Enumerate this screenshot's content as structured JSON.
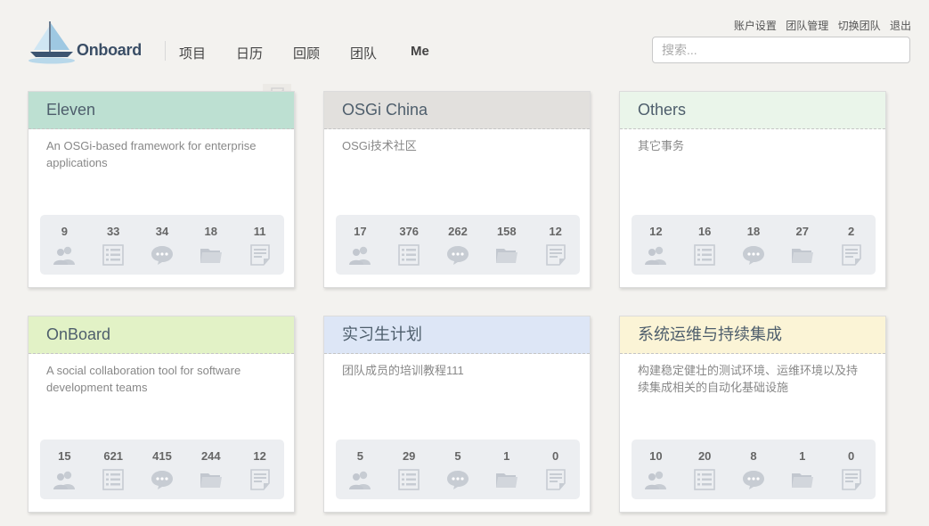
{
  "brand": {
    "name": "Onboard"
  },
  "nav": [
    "项目",
    "日历",
    "回顾",
    "团队",
    "Me"
  ],
  "account_links": [
    "账户设置",
    "团队管理",
    "切换团队",
    "退出"
  ],
  "search": {
    "placeholder": "搜索..."
  },
  "projects": [
    {
      "title": "Eleven",
      "description": "An OSGi-based framework for enterprise applications",
      "header_color": "#bde0d2",
      "stats": [
        "9",
        "33",
        "34",
        "18",
        "11"
      ]
    },
    {
      "title": "OSGi China",
      "description": "OSGi技术社区",
      "header_color": "#e2e0dd",
      "stats": [
        "17",
        "376",
        "262",
        "158",
        "12"
      ]
    },
    {
      "title": "Others",
      "description": "其它事务",
      "header_color": "#eaf5ea",
      "stats": [
        "12",
        "16",
        "18",
        "27",
        "2"
      ]
    },
    {
      "title": "OnBoard",
      "description": "A social collaboration tool for software development teams",
      "header_color": "#e2f2c6",
      "stats": [
        "15",
        "621",
        "415",
        "244",
        "12"
      ]
    },
    {
      "title": "实习生计划",
      "description": "团队成员的培训教程111",
      "header_color": "#dde6f6",
      "stats": [
        "5",
        "29",
        "5",
        "1",
        "0"
      ]
    },
    {
      "title": "系统运维与持续集成",
      "description": "构建稳定健壮的测试环境、运维环境以及持续集成相关的自动化基础设施",
      "header_color": "#fbf4d6",
      "stats": [
        "10",
        "20",
        "8",
        "1",
        "0"
      ]
    }
  ],
  "stat_icons": [
    "members-icon",
    "todo-list-icon",
    "discussion-icon",
    "folder-icon",
    "document-icon"
  ]
}
